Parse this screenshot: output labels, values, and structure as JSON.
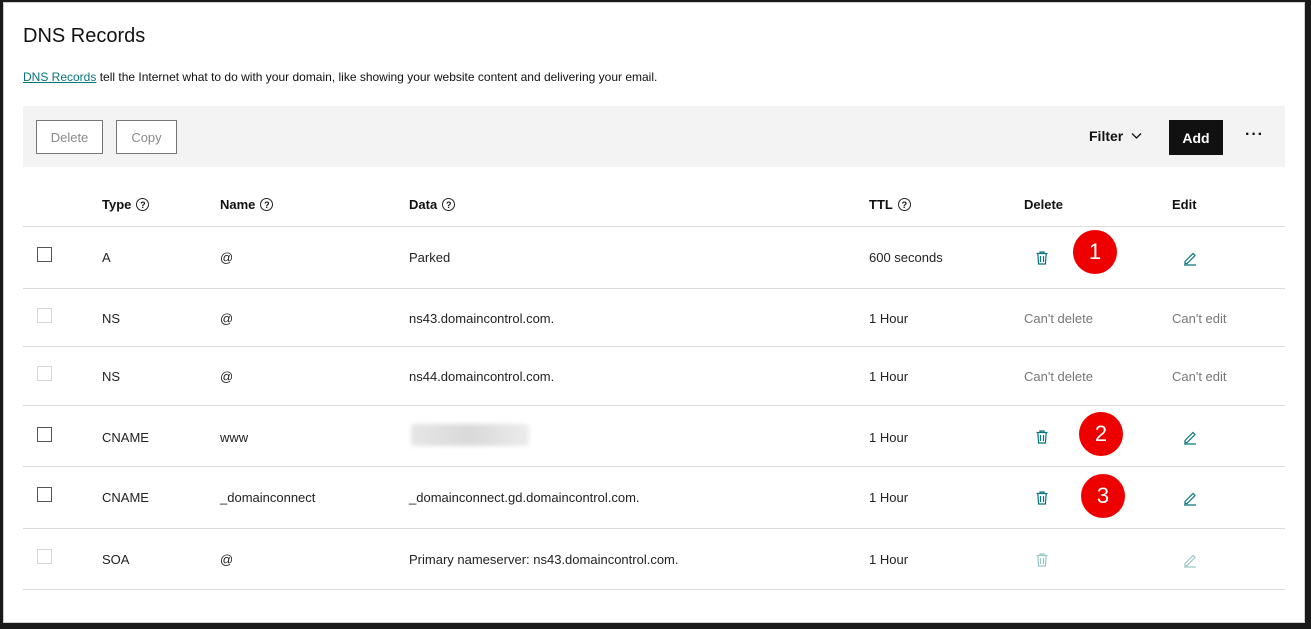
{
  "page": {
    "title": "DNS Records",
    "description_link": "DNS Records",
    "description_text": " tell the Internet what to do with your domain, like showing your website content and delivering your email."
  },
  "toolbar": {
    "delete_label": "Delete",
    "copy_label": "Copy",
    "filter_label": "Filter",
    "add_label": "Add",
    "more_label": "···"
  },
  "columns": {
    "type": "Type",
    "name": "Name",
    "data": "Data",
    "ttl": "TTL",
    "delete": "Delete",
    "edit": "Edit"
  },
  "records": [
    {
      "type": "A",
      "name": "@",
      "data": "Parked",
      "ttl": "600 seconds",
      "delete": "",
      "edit": ""
    },
    {
      "type": "NS",
      "name": "@",
      "data": "ns43.domaincontrol.com.",
      "ttl": "1 Hour",
      "delete": "Can't delete",
      "edit": "Can't edit"
    },
    {
      "type": "NS",
      "name": "@",
      "data": "ns44.domaincontrol.com.",
      "ttl": "1 Hour",
      "delete": "Can't delete",
      "edit": "Can't edit"
    },
    {
      "type": "CNAME",
      "name": "www",
      "data": "",
      "ttl": "1 Hour",
      "delete": "",
      "edit": ""
    },
    {
      "type": "CNAME",
      "name": "_domainconnect",
      "data": "_domainconnect.gd.domaincontrol.com.",
      "ttl": "1 Hour",
      "delete": "",
      "edit": ""
    },
    {
      "type": "SOA",
      "name": "@",
      "data": "Primary nameserver: ns43.domaincontrol.com.",
      "ttl": "1 Hour",
      "delete": "",
      "edit": ""
    }
  ],
  "markers": [
    "1",
    "2",
    "3"
  ],
  "colors": {
    "accent": "#09757a",
    "marker": "#ee0000",
    "add_button": "#111111"
  }
}
